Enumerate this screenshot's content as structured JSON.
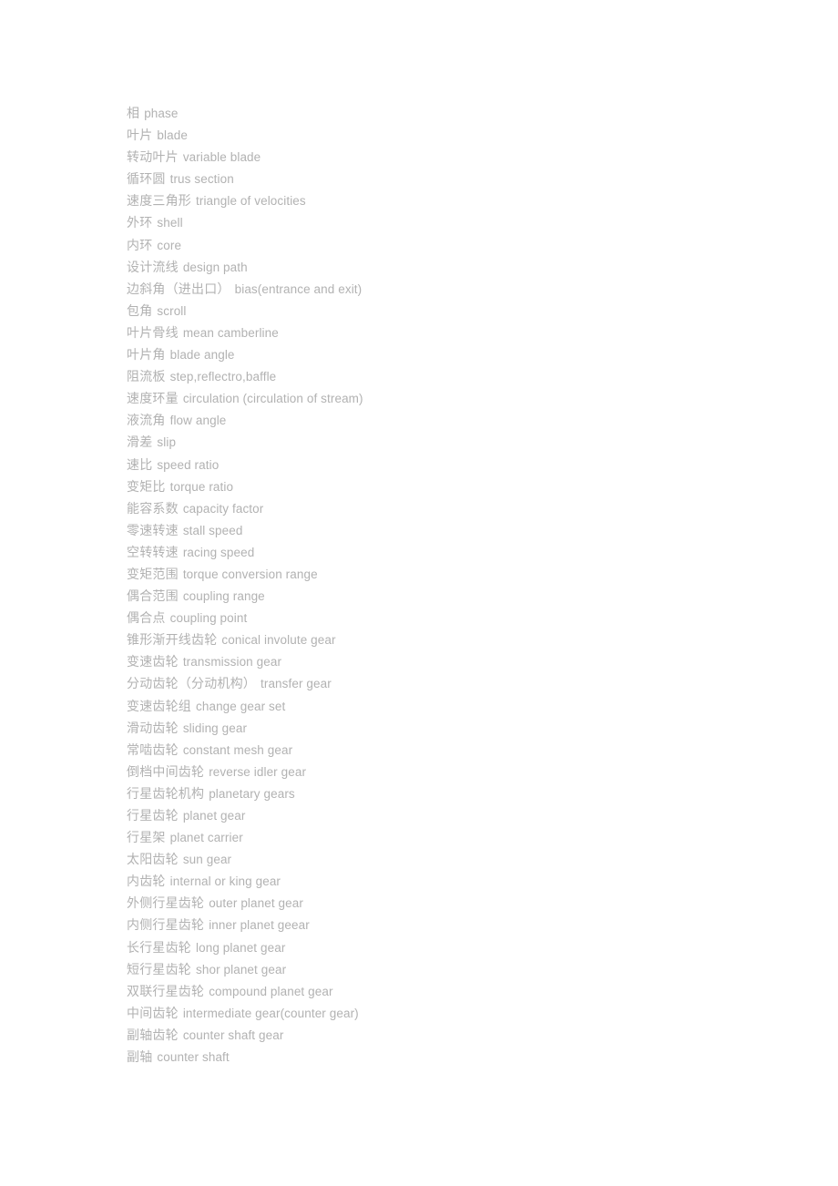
{
  "document": {
    "background_color": "#ffffff",
    "text_color": "#b2b2b2",
    "entry_count": 44
  },
  "glossary": {
    "entries": [
      {
        "zh": "相",
        "en": "phase"
      },
      {
        "zh": "叶片",
        "en": "blade"
      },
      {
        "zh": "转动叶片",
        "en": "variable blade"
      },
      {
        "zh": "循环圆",
        "en": "trus section"
      },
      {
        "zh": "速度三角形",
        "en": "triangle of velocities"
      },
      {
        "zh": "外环",
        "en": "shell"
      },
      {
        "zh": "内环",
        "en": "core"
      },
      {
        "zh": "设计流线",
        "en": "design path"
      },
      {
        "zh": "边斜角（进出口）",
        "en": "bias(entrance and exit)"
      },
      {
        "zh": "包角",
        "en": "scroll"
      },
      {
        "zh": "叶片骨线",
        "en": "mean camberline"
      },
      {
        "zh": "叶片角",
        "en": "blade angle"
      },
      {
        "zh": "阻流板",
        "en": "step,reflectro,baffle"
      },
      {
        "zh": "速度环量",
        "en": "circulation (circulation of stream)"
      },
      {
        "zh": "液流角",
        "en": "flow angle"
      },
      {
        "zh": "滑差",
        "en": "slip"
      },
      {
        "zh": "速比",
        "en": "speed ratio"
      },
      {
        "zh": "变矩比",
        "en": "torque ratio"
      },
      {
        "zh": "能容系数",
        "en": "capacity factor"
      },
      {
        "zh": "零速转速",
        "en": "stall speed"
      },
      {
        "zh": "空转转速",
        "en": "racing speed"
      },
      {
        "zh": "变矩范围",
        "en": "torque conversion range"
      },
      {
        "zh": "偶合范围",
        "en": "coupling range"
      },
      {
        "zh": "偶合点",
        "en": "coupling point"
      },
      {
        "zh": "锥形渐开线齿轮",
        "en": "conical involute gear"
      },
      {
        "zh": "变速齿轮",
        "en": "transmission gear"
      },
      {
        "zh": "分动齿轮（分动机构）",
        "en": "transfer gear"
      },
      {
        "zh": "变速齿轮组",
        "en": "change gear set"
      },
      {
        "zh": "滑动齿轮",
        "en": "sliding gear"
      },
      {
        "zh": "常啮齿轮",
        "en": "constant mesh gear"
      },
      {
        "zh": "倒档中间齿轮",
        "en": "reverse idler gear"
      },
      {
        "zh": "行星齿轮机构",
        "en": "planetary gears"
      },
      {
        "zh": "行星齿轮",
        "en": "planet gear"
      },
      {
        "zh": "行星架",
        "en": "planet carrier"
      },
      {
        "zh": "太阳齿轮",
        "en": "sun gear"
      },
      {
        "zh": "内齿轮",
        "en": "internal or king gear"
      },
      {
        "zh": "外侧行星齿轮",
        "en": "outer planet gear"
      },
      {
        "zh": "内侧行星齿轮",
        "en": "inner planet geear"
      },
      {
        "zh": "长行星齿轮",
        "en": "long planet gear"
      },
      {
        "zh": "短行星齿轮",
        "en": "shor planet gear"
      },
      {
        "zh": "双联行星齿轮",
        "en": "compound planet gear"
      },
      {
        "zh": "中间齿轮",
        "en": "intermediate gear(counter gear)"
      },
      {
        "zh": "副轴齿轮",
        "en": "counter shaft gear"
      },
      {
        "zh": "副轴",
        "en": "counter shaft"
      }
    ]
  }
}
